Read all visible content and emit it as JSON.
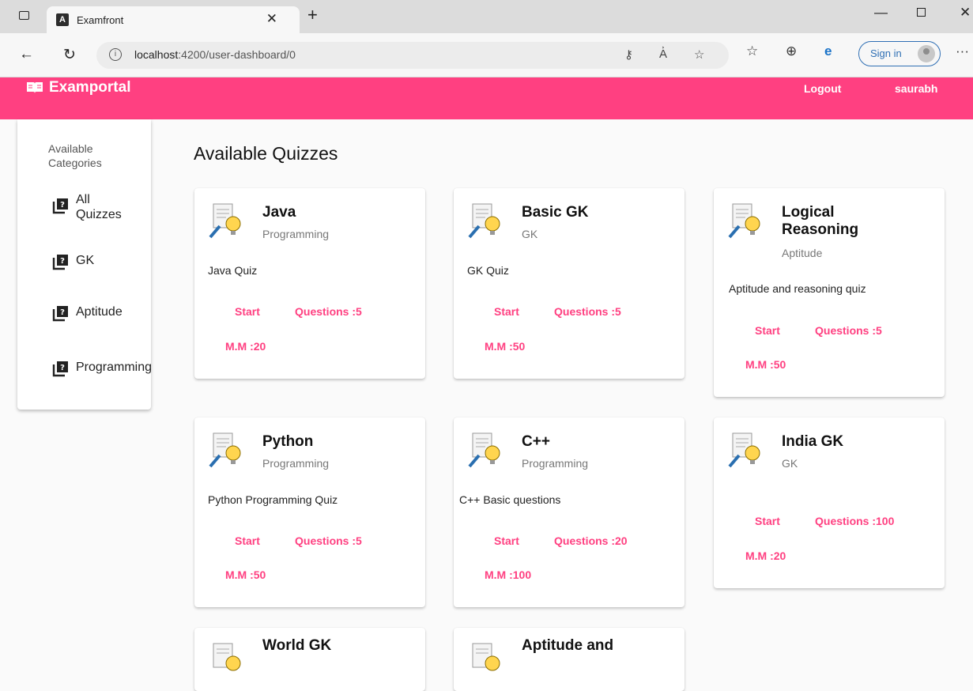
{
  "browser": {
    "tab_title": "Examfront",
    "url_host": "localhost",
    "url_rest": ":4200/user-dashboard/0",
    "signin_label": "Sign in",
    "more_label": "···"
  },
  "app": {
    "brand": "Examportal",
    "logout_label": "Logout",
    "username": "saurabh"
  },
  "sidebar": {
    "heading": "Available Categories",
    "items": [
      {
        "label": "All Quizzes"
      },
      {
        "label": "GK"
      },
      {
        "label": "Aptitude"
      },
      {
        "label": "Programming"
      }
    ]
  },
  "main": {
    "title": "Available Quizzes",
    "start_label": "Start",
    "quizzes": [
      {
        "title": "Java",
        "category": "Programming",
        "description": "Java Quiz",
        "questions": "Questions :5",
        "max_marks": "M.M :20"
      },
      {
        "title": "Basic GK",
        "category": "GK",
        "description": "GK Quiz",
        "questions": "Questions :5",
        "max_marks": "M.M :50"
      },
      {
        "title": "Logical Reasoning",
        "category": "Aptitude",
        "description": "Aptitude and reasoning quiz",
        "questions": "Questions :5",
        "max_marks": "M.M :50"
      },
      {
        "title": "Python",
        "category": "Programming",
        "description": "Python Programming Quiz",
        "questions": "Questions :5",
        "max_marks": "M.M :50"
      },
      {
        "title": "C++",
        "category": "Programming",
        "description": "C++ Basic questions",
        "questions": "Questions :20",
        "max_marks": "M.M :100"
      },
      {
        "title": "India GK",
        "category": "GK",
        "description": "",
        "questions": "Questions :100",
        "max_marks": "M.M :20"
      },
      {
        "title": "World GK"
      },
      {
        "title": "Aptitude and"
      }
    ]
  },
  "colors": {
    "accent": "#ff4081",
    "toolbar_text": "#ffffff"
  }
}
